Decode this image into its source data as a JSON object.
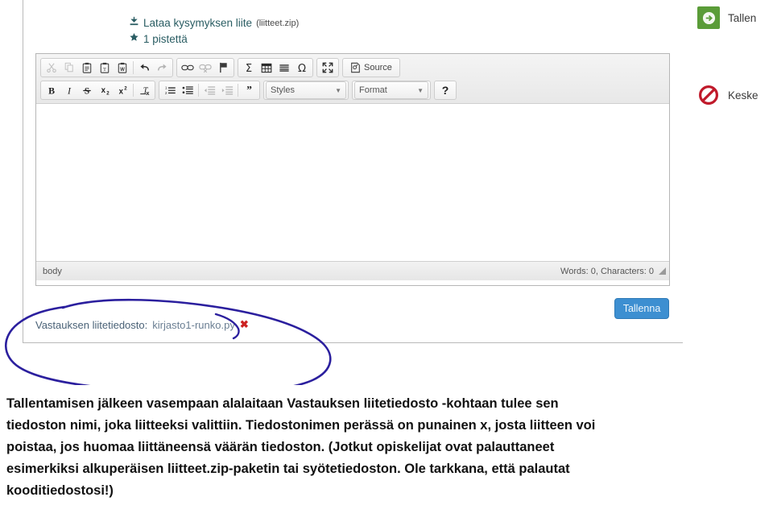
{
  "question_header": {
    "download_link": "Lataa kysymyksen liite",
    "download_file": "(liitteet.zip)",
    "points": "1 pistettä",
    "download_icon": "download-icon",
    "points_icon": "star-icon"
  },
  "editor": {
    "toolbar_row1": [
      {
        "name": "cut",
        "title": "Cut",
        "glyph": "scissors-icon",
        "disabled": true
      },
      {
        "name": "copy",
        "title": "Copy",
        "glyph": "copy-icon",
        "disabled": true
      },
      {
        "name": "paste",
        "title": "Paste",
        "glyph": "clipboard-icon",
        "disabled": false
      },
      {
        "name": "paste-text",
        "title": "Paste as plain text",
        "glyph": "clipboard-text-icon",
        "disabled": false
      },
      {
        "name": "paste-word",
        "title": "Paste from Word",
        "glyph": "clipboard-word-icon",
        "disabled": false
      },
      {
        "name": "undo",
        "title": "Undo",
        "glyph": "undo-arrow-icon",
        "disabled": false
      },
      {
        "name": "redo",
        "title": "Redo",
        "glyph": "redo-arrow-icon",
        "disabled": true
      },
      {
        "name": "link",
        "title": "Link",
        "glyph": "link-icon",
        "disabled": false
      },
      {
        "name": "unlink",
        "title": "Unlink",
        "glyph": "unlink-icon",
        "disabled": true
      },
      {
        "name": "anchor",
        "title": "Anchor",
        "glyph": "flag-icon",
        "disabled": false
      },
      {
        "name": "math",
        "title": "Mathematics",
        "glyph": "sigma-icon",
        "disabled": false
      },
      {
        "name": "table",
        "title": "Table",
        "glyph": "table-icon",
        "disabled": false
      },
      {
        "name": "hrule",
        "title": "Horizontal line",
        "glyph": "horizontal-line-icon",
        "disabled": false
      },
      {
        "name": "special-char",
        "title": "Special character",
        "glyph": "omega-icon",
        "disabled": false
      },
      {
        "name": "maximize",
        "title": "Maximize",
        "glyph": "maximize-icon",
        "disabled": false
      }
    ],
    "source_label": "Source",
    "toolbar_row2": [
      {
        "name": "bold",
        "title": "Bold",
        "glyph": "bold-icon",
        "disabled": false
      },
      {
        "name": "italic",
        "title": "Italic",
        "glyph": "italic-icon",
        "disabled": false
      },
      {
        "name": "strike",
        "title": "Strikethrough",
        "glyph": "strikethrough-icon",
        "disabled": false
      },
      {
        "name": "subscript",
        "title": "Subscript",
        "glyph": "subscript-icon",
        "disabled": false
      },
      {
        "name": "superscript",
        "title": "Superscript",
        "glyph": "superscript-icon",
        "disabled": false
      },
      {
        "name": "remove-format",
        "title": "Remove format",
        "glyph": "remove-format-icon",
        "disabled": false
      },
      {
        "name": "numbered-list",
        "title": "Numbered list",
        "glyph": "numbered-list-icon",
        "disabled": false
      },
      {
        "name": "bulleted-list",
        "title": "Bulleted list",
        "glyph": "bulleted-list-icon",
        "disabled": false
      },
      {
        "name": "outdent",
        "title": "Decrease indent",
        "glyph": "outdent-icon",
        "disabled": true
      },
      {
        "name": "indent",
        "title": "Increase indent",
        "glyph": "indent-icon",
        "disabled": true
      },
      {
        "name": "blockquote",
        "title": "Block quote",
        "glyph": "quote-icon",
        "disabled": false
      }
    ],
    "styles_label": "Styles",
    "format_label": "Format",
    "help_label": "?",
    "body_value": "",
    "status_path": "body",
    "status_counts": "Words: 0, Characters: 0"
  },
  "attachment": {
    "label": "Vastauksen liitetiedosto:",
    "filename": "kirjasto1-runko.py",
    "remove_icon": "remove-x-icon",
    "remove_mark": "✖"
  },
  "save_button": "Tallenna",
  "rail": [
    {
      "name": "rail-save",
      "label": "Tallen",
      "icon": "save-arrow-icon",
      "color": "#5a9c38"
    },
    {
      "name": "rail-cancel",
      "label": "Keske",
      "icon": "cancel-prohibit-icon",
      "color": "#c01a2b"
    }
  ],
  "annotation": {
    "name": "hand-drawn-ellipse",
    "color": "#2b1f9e"
  },
  "caption": [
    "Tallentamisen jälkeen vasempaan alalaitaan Vastauksen liitetiedosto -kohtaan tulee sen",
    "tiedoston nimi, joka liitteeksi valittiin. Tiedostonimen perässä on punainen x, josta liitteen voi",
    "poistaa, jos huomaa liittäneensä väärän tiedoston. (Jotkut opiskelijat ovat palauttaneet",
    "esimerkiksi alkuperäisen liitteet.zip-paketin tai syötetiedoston. Ole tarkkana, että palautat",
    "kooditiedostosi!)"
  ]
}
